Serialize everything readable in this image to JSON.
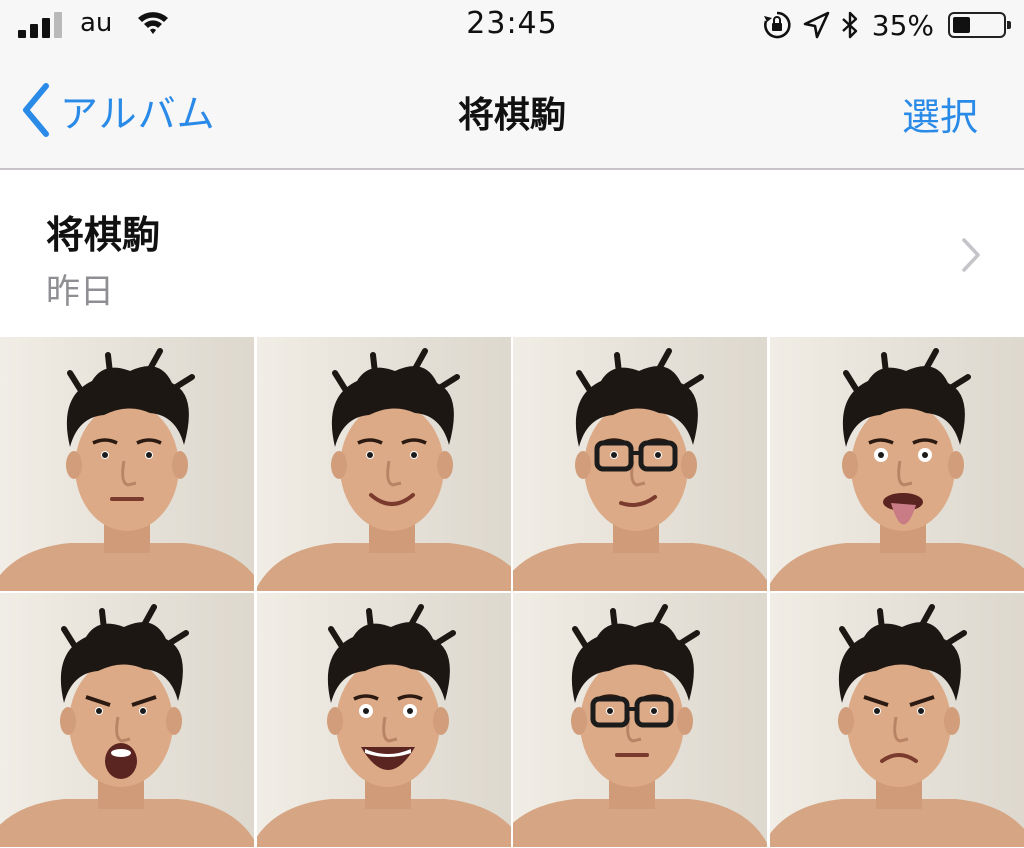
{
  "status_bar": {
    "carrier": "au",
    "time": "23:45",
    "battery_percent": "35%",
    "battery_level": 0.35,
    "icons": [
      "signal-icon",
      "wifi-icon",
      "orientation-lock-icon",
      "location-icon",
      "bluetooth-icon",
      "battery-icon"
    ]
  },
  "nav": {
    "back_label": "アルバム",
    "title": "将棋駒",
    "select_label": "選択"
  },
  "album": {
    "title": "将棋駒",
    "date": "昨日"
  },
  "photos": [
    {
      "expression": "neutral"
    },
    {
      "expression": "smile"
    },
    {
      "expression": "glasses-smirk"
    },
    {
      "expression": "tongue-out"
    },
    {
      "expression": "shout"
    },
    {
      "expression": "wide-grin"
    },
    {
      "expression": "glasses-neutral"
    },
    {
      "expression": "frown"
    }
  ],
  "colors": {
    "accent": "#2a8ae8",
    "bar_background": "#f7f7f7",
    "secondary_text": "#8e8e93"
  }
}
